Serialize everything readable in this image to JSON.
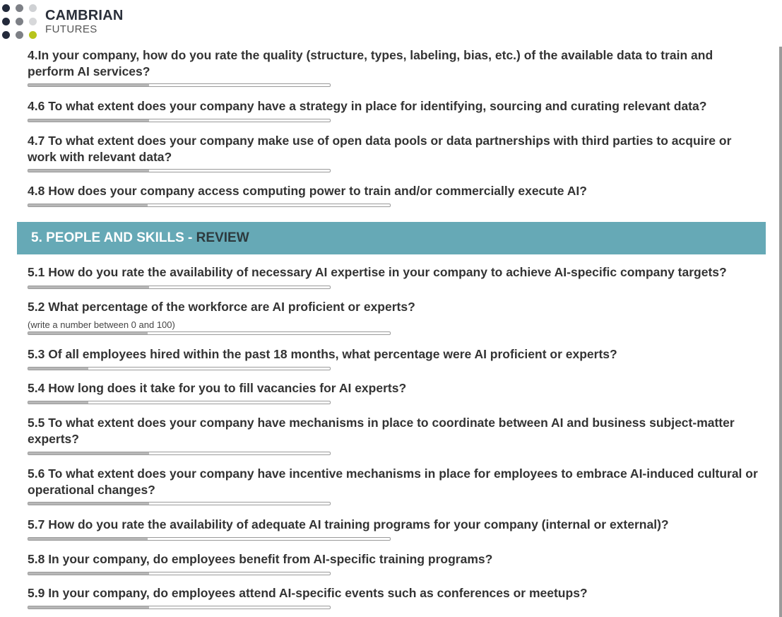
{
  "logo": {
    "title": "CAMBRIAN",
    "subtitle": "FUTURES",
    "dot_colors": [
      "#232a3b",
      "#7d8086",
      "#cfd1d4",
      "#232a3b",
      "#7d8086",
      "#d7d8da",
      "#232a3b",
      "#7d8086",
      "#b7c41c"
    ]
  },
  "questions_top": [
    {
      "text": "4.In your company, how do you rate the quality (structure, types, labeling, bias, etc.) of the available data to train and perform AI services?",
      "fill": 0.4
    },
    {
      "text": "4.6 To what extent does your company have a strategy in place for identifying, sourcing and curating relevant data?",
      "fill": 0.4
    },
    {
      "text": "4.7 To what extent does your company make use of open data pools or data partnerships with third parties to acquire or work with relevant data?",
      "fill": 0.4
    },
    {
      "text": "4.8 How does your company access computing power to train and/or commercially execute AI?",
      "fill": 0.33
    }
  ],
  "section": {
    "title": "5. PEOPLE AND SKILLS - ",
    "suffix": "REVIEW"
  },
  "questions": [
    {
      "text": "5.1 How do you rate the availability of necessary AI expertise in your company to achieve AI-specific company targets?",
      "fill": 0.4
    },
    {
      "text": "5.2 What percentage of the workforce are AI proficient or experts?",
      "hint": "(write a number between 0 and 100)",
      "fill": 0.33
    },
    {
      "text": "5.3 Of all employees hired within the past 18 months, what percentage were AI proficient or experts?",
      "fill": 0.2
    },
    {
      "text": "5.4 How long does it take for you to fill vacancies for AI experts?",
      "fill": 0.2
    },
    {
      "text": "5.5 To what extent does your company have mechanisms in place to coordinate between AI and business subject-matter experts?",
      "fill": 0.4
    },
    {
      "text": "5.6 To what extent does your company have incentive mechanisms in place for employees to embrace AI-induced cultural or operational changes?",
      "fill": 0.4
    },
    {
      "text": "5.7 How do you rate the availability of adequate AI training programs for your company (internal or external)?",
      "fill": 0.33
    },
    {
      "text": "5.8 In your company, do employees benefit from AI-specific training programs?",
      "fill": 0.4
    },
    {
      "text": "5.9 In your company, do employees attend AI-specific events such as conferences or meetups?",
      "fill": 0.4
    }
  ]
}
